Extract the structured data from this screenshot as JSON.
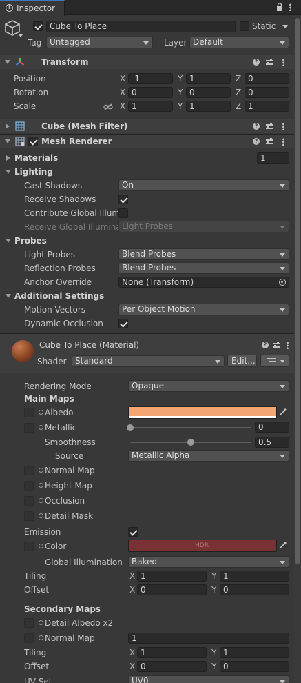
{
  "tab": {
    "title": "Inspector"
  },
  "object": {
    "name": "Cube To Place",
    "static_label": "Static",
    "tag_label": "Tag",
    "tag_value": "Untagged",
    "layer_label": "Layer",
    "layer_value": "Default"
  },
  "transform": {
    "title": "Transform",
    "rows": [
      {
        "label": "Position",
        "x": "-1",
        "y": "1",
        "z": "0"
      },
      {
        "label": "Rotation",
        "x": "0",
        "y": "0",
        "z": "0"
      },
      {
        "label": "Scale",
        "x": "1",
        "y": "1",
        "z": "1"
      }
    ],
    "axes": {
      "x": "X",
      "y": "Y",
      "z": "Z"
    }
  },
  "mesh_filter": {
    "title": "Cube (Mesh Filter)"
  },
  "mesh_renderer": {
    "title": "Mesh Renderer",
    "materials_label": "Materials",
    "materials_count": "1",
    "lighting_label": "Lighting",
    "cast_shadows_label": "Cast Shadows",
    "cast_shadows_value": "On",
    "receive_shadows_label": "Receive Shadows",
    "contribute_gi_label": "Contribute Global Illumin",
    "receive_gi_label": "Receive Global Illuminat",
    "receive_gi_value": "Light Probes",
    "probes_label": "Probes",
    "light_probes_label": "Light Probes",
    "light_probes_value": "Blend Probes",
    "reflection_probes_label": "Reflection Probes",
    "reflection_probes_value": "Blend Probes",
    "anchor_override_label": "Anchor Override",
    "anchor_override_value": "None (Transform)",
    "additional_label": "Additional Settings",
    "motion_vectors_label": "Motion Vectors",
    "motion_vectors_value": "Per Object Motion",
    "dynamic_occlusion_label": "Dynamic Occlusion"
  },
  "material": {
    "title": "Cube To Place (Material)",
    "shader_label": "Shader",
    "shader_value": "Standard",
    "edit_label": "Edit...",
    "rendering_mode_label": "Rendering Mode",
    "rendering_mode_value": "Opaque",
    "main_maps_label": "Main Maps",
    "albedo_label": "Albedo",
    "albedo_color": "#f4a672",
    "metallic_label": "Metallic",
    "metallic_value": "0",
    "metallic_level": 0.0,
    "smoothness_label": "Smoothness",
    "smoothness_value": "0.5",
    "smoothness_level": 0.5,
    "source_label": "Source",
    "source_value": "Metallic Alpha",
    "normal_map_label": "Normal Map",
    "height_map_label": "Height Map",
    "occlusion_label": "Occlusion",
    "detail_mask_label": "Detail Mask",
    "emission_label": "Emission",
    "color_label": "Color",
    "emission_color": "#7a3134",
    "hdr_label": "HDR",
    "gi_label": "Global Illumination",
    "gi_value": "Baked",
    "tiling_label": "Tiling",
    "tiling_x": "1",
    "tiling_y": "1",
    "offset_label": "Offset",
    "offset_x": "0",
    "offset_y": "0",
    "secondary_maps_label": "Secondary Maps",
    "detail_albedo_label": "Detail Albedo x2",
    "sec_normal_map_label": "Normal Map",
    "sec_normal_value": "1",
    "sec_tiling_x": "1",
    "sec_tiling_y": "1",
    "sec_offset_x": "0",
    "sec_offset_y": "0",
    "uv_set_label": "UV Set",
    "uv_set_value": "UV0"
  }
}
